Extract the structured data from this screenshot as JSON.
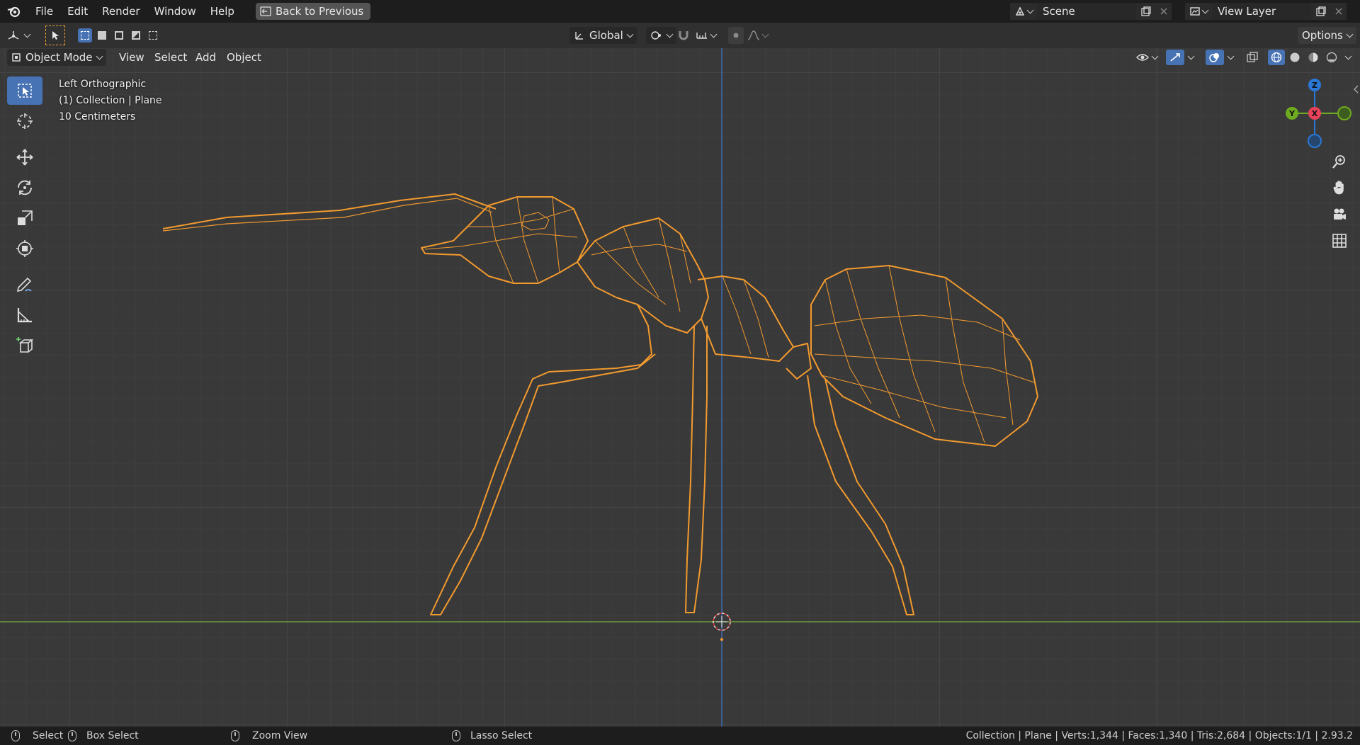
{
  "menu": {
    "items": [
      "File",
      "Edit",
      "Render",
      "Window",
      "Help"
    ],
    "back_label": "Back to Previous"
  },
  "scene": {
    "label": "Scene",
    "icon": "scene-icon"
  },
  "view_layer": {
    "label": "View Layer",
    "icon": "view-layer-icon"
  },
  "tool_header": {
    "orientation": "Global",
    "options_label": "Options"
  },
  "view_header": {
    "mode": "Object Mode",
    "menus": [
      "View",
      "Select",
      "Add",
      "Object"
    ]
  },
  "viewport": {
    "view_name": "Left Orthographic",
    "collection_line": "(1) Collection | Plane",
    "scale_line": "10 Centimeters",
    "wire_color": "#f29a2e",
    "x_axis_line_color": "#6e9a3c",
    "z_axis_line_color": "#3a6bb3"
  },
  "gizmo": {
    "z_label": "Z",
    "y_label": "Y",
    "x_label": "X",
    "z_color": "#2a77d6",
    "y_color": "#6fab20",
    "x_color": "#e8415a"
  },
  "toolbar": {
    "tools": [
      "select-box",
      "cursor",
      "move",
      "rotate",
      "scale",
      "transform",
      "annotate",
      "measure",
      "add-cube"
    ]
  },
  "status": {
    "select": "Select",
    "box_select": "Box Select",
    "zoom_view": "Zoom View",
    "lasso_select": "Lasso Select",
    "stats": "Collection | Plane | Verts:1,344 | Faces:1,340 | Tris:2,684 | Objects:1/1 | 2.93.2"
  }
}
